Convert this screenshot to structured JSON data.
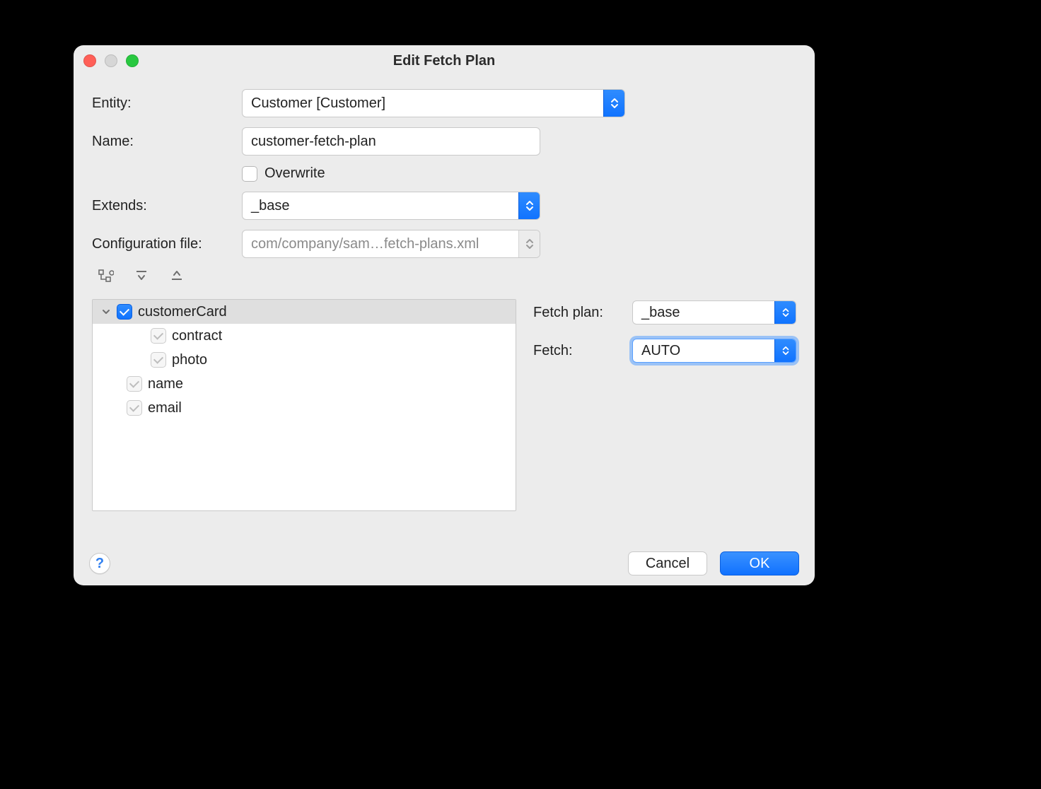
{
  "title": "Edit Fetch Plan",
  "form": {
    "entity_label": "Entity:",
    "entity_value": "Customer [Customer]",
    "name_label": "Name:",
    "name_value": "customer-fetch-plan",
    "overwrite_label": "Overwrite",
    "overwrite_checked": false,
    "extends_label": "Extends:",
    "extends_value": "_base",
    "config_label": "Configuration file:",
    "config_value": "com/company/sam…fetch-plans.xml"
  },
  "tree": {
    "items": [
      {
        "label": "customerCard",
        "checked": "on",
        "depth": 0,
        "expanded": true,
        "selected": true
      },
      {
        "label": "contract",
        "checked": "dim",
        "depth": 2
      },
      {
        "label": "photo",
        "checked": "dim",
        "depth": 2
      },
      {
        "label": "name",
        "checked": "dim",
        "depth": 1
      },
      {
        "label": "email",
        "checked": "dim",
        "depth": 1
      }
    ]
  },
  "detail": {
    "fetchplan_label": "Fetch plan:",
    "fetchplan_value": "_base",
    "fetch_label": "Fetch:",
    "fetch_value": "AUTO"
  },
  "footer": {
    "cancel": "Cancel",
    "ok": "OK"
  }
}
